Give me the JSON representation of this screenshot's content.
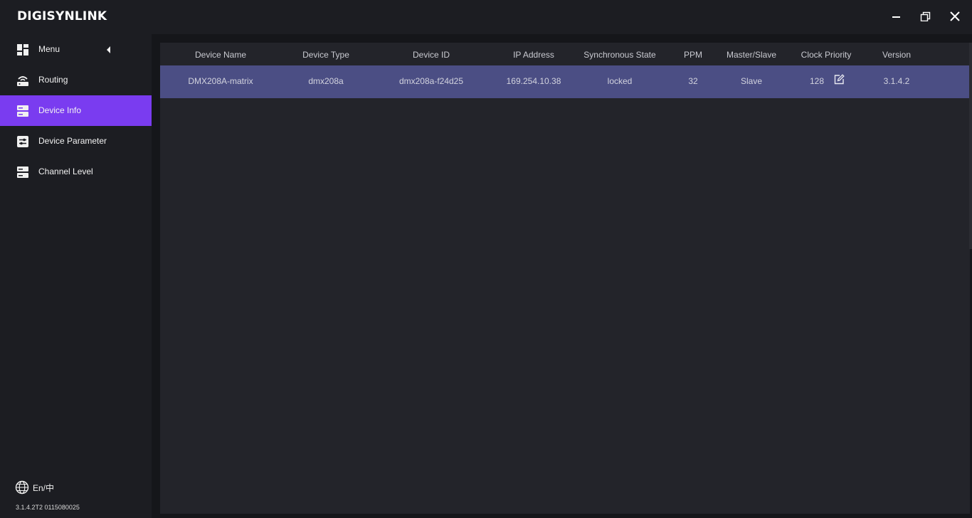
{
  "app": {
    "title": "DIGISYNLINK"
  },
  "sidebar": {
    "menu_label": "Menu",
    "items": [
      {
        "label": "Routing",
        "icon": "wifi-router-icon"
      },
      {
        "label": "Device Info",
        "icon": "server-icon",
        "active": true
      },
      {
        "label": "Device Parameter",
        "icon": "sliders-icon"
      },
      {
        "label": "Channel Level",
        "icon": "server-icon"
      }
    ],
    "language": "En/中",
    "build": "3.1.4.2T2  0115080025"
  },
  "table": {
    "columns": [
      "Device Name",
      "Device Type",
      "Device ID",
      "IP Address",
      "Synchronous State",
      "PPM",
      "Master/Slave",
      "Clock Priority",
      "Version"
    ],
    "rows": [
      {
        "device_name": "DMX208A-matrix",
        "device_type": "dmx208a",
        "device_id": "dmx208a-f24d25",
        "ip_address": "169.254.10.38",
        "sync_state": "locked",
        "ppm": "32",
        "master_slave": "Slave",
        "clock_priority": "128",
        "version": "3.1.4.2"
      }
    ]
  },
  "colors": {
    "accent": "#7a3cf0",
    "selected_row": "#4b4e84",
    "background": "#1c1d22"
  }
}
